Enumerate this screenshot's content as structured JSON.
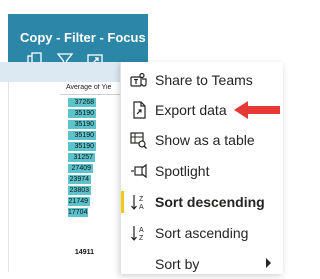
{
  "visual_header": {
    "title": "Copy - Filter - Focus",
    "toolbar": [
      {
        "icon": "copy-icon"
      },
      {
        "icon": "filter-icon"
      },
      {
        "icon": "focus-mode-icon"
      },
      {
        "icon": "more-options-icon"
      }
    ],
    "accent": "#2b86a8"
  },
  "table": {
    "column_header": "Average of Yie",
    "values": [
      "37268",
      "35190",
      "35190",
      "35190",
      "35190",
      "31257",
      "27409",
      "23974",
      "23803",
      "21749",
      "17704"
    ],
    "total": "14911",
    "bar_color": "#5cc3cc"
  },
  "context_menu": {
    "items": [
      {
        "label": "Share to Teams",
        "icon": "teams-icon"
      },
      {
        "label": "Export data",
        "icon": "export-data-icon"
      },
      {
        "label": "Show as a table",
        "icon": "show-as-table-icon"
      },
      {
        "label": "Spotlight",
        "icon": "spotlight-icon"
      },
      {
        "label": "Sort descending",
        "icon": "sort-descending-icon",
        "selected": true
      },
      {
        "label": "Sort ascending",
        "icon": "sort-ascending-icon"
      },
      {
        "label": "Sort by",
        "icon": "",
        "submenu": true
      }
    ],
    "selection_color": "#f2c811"
  },
  "annotation": {
    "arrow_color": "#e53935",
    "points_to": "Export data"
  }
}
